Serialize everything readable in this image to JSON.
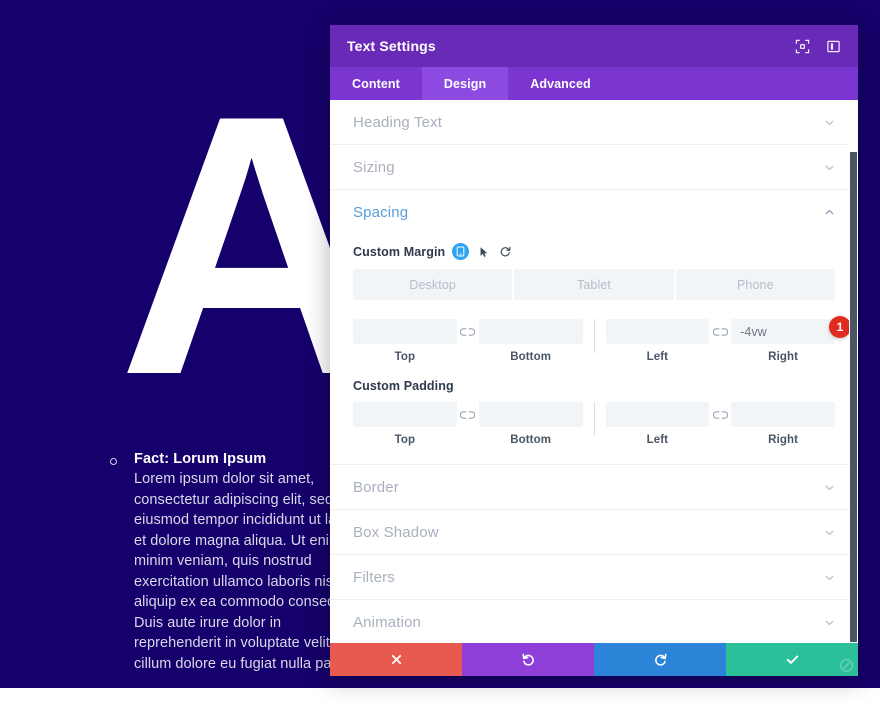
{
  "background": {
    "hero_letter": "A",
    "bg_color": "#16006b",
    "fact": {
      "title": "Fact: Lorum Ipsum",
      "body": "Lorem ipsum dolor sit amet, consectetur adipiscing elit, sed do eiusmod tempor incididunt ut labore et dolore magna aliqua. Ut enim ad minim veniam, quis nostrud exercitation ullamco laboris nisi ut aliquip ex ea commodo consequat. Duis aute irure dolor in reprehenderit in voluptate velit esse cillum dolore eu fugiat nulla pariatur."
    }
  },
  "modal": {
    "title": "Text Settings",
    "header_color": "#6a2ab8",
    "tabbar_color": "#7b35d0",
    "active_tab_color": "#8d4ae0",
    "header_icons": [
      {
        "name": "fullscreen-icon"
      },
      {
        "name": "split-view-icon"
      }
    ],
    "tabs": [
      {
        "label": "Content",
        "active": false
      },
      {
        "label": "Design",
        "active": true
      },
      {
        "label": "Advanced",
        "active": false
      }
    ],
    "sections": [
      {
        "label": "Heading Text",
        "open": false
      },
      {
        "label": "Sizing",
        "open": false
      },
      {
        "label": "Spacing",
        "open": true
      },
      {
        "label": "Border",
        "open": false
      },
      {
        "label": "Box Shadow",
        "open": false
      },
      {
        "label": "Filters",
        "open": false
      },
      {
        "label": "Animation",
        "open": false
      }
    ],
    "spacing": {
      "margin": {
        "label": "Custom Margin",
        "icons": [
          {
            "name": "responsive-toggle-icon",
            "color": "#2ea3f2"
          },
          {
            "name": "hover-cursor-icon"
          },
          {
            "name": "reset-icon"
          }
        ],
        "devices": [
          {
            "label": "Desktop",
            "active": true
          },
          {
            "label": "Tablet",
            "active": false
          },
          {
            "label": "Phone",
            "active": false
          }
        ],
        "fields": [
          {
            "caption": "Top",
            "value": "",
            "placeholder": ""
          },
          {
            "caption": "Bottom",
            "value": "",
            "placeholder": ""
          },
          {
            "caption": "Left",
            "value": "",
            "placeholder": ""
          },
          {
            "caption": "Right",
            "value": "-4vw",
            "placeholder": ""
          }
        ],
        "badge": "1",
        "badge_color": "#e02b20"
      },
      "padding": {
        "label": "Custom Padding",
        "fields": [
          {
            "caption": "Top",
            "value": "",
            "placeholder": ""
          },
          {
            "caption": "Bottom",
            "value": "",
            "placeholder": ""
          },
          {
            "caption": "Left",
            "value": "",
            "placeholder": ""
          },
          {
            "caption": "Right",
            "value": "",
            "placeholder": ""
          }
        ]
      }
    },
    "footer": [
      {
        "name": "cancel-button",
        "icon": "close-icon",
        "color": "#e8594f"
      },
      {
        "name": "undo-button",
        "icon": "undo-icon",
        "color": "#8d3fd8"
      },
      {
        "name": "redo-button",
        "icon": "redo-icon",
        "color": "#2b84d8"
      },
      {
        "name": "save-button",
        "icon": "check-icon",
        "color": "#2bbf9a"
      }
    ]
  }
}
